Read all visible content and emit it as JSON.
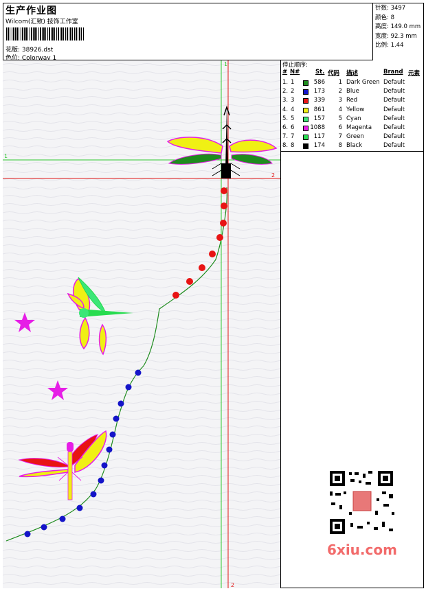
{
  "header": {
    "title": "生产作业图",
    "subtitle": "Wilcom(汇致) 技饰工作室",
    "design_label": "花版: 38926.dst",
    "colorway_label": "色位: Colorway 1"
  },
  "stats": {
    "stitches": "针数: 3497",
    "colors": "颜色: 8",
    "height": "高度: 149.0 mm",
    "width": "宽度: 92.3 mm",
    "scale": "比例: 1.44"
  },
  "canvas": {
    "guide_label_v1": "1",
    "guide_label_h1": "1",
    "guide_label_h2": "2",
    "guide_label_v2": "2"
  },
  "stop_sequence": {
    "title": "停止顺序:",
    "headers": [
      "#",
      "N#",
      "St.",
      "代码",
      "描述",
      "Brand",
      "元素"
    ],
    "rows": [
      {
        "num": "1.",
        "n": "1",
        "color": "#1e8c1e",
        "st": "586",
        "code": "1",
        "desc": "Dark Green",
        "brand": "Default"
      },
      {
        "num": "2.",
        "n": "2",
        "color": "#1414c8",
        "st": "173",
        "code": "2",
        "desc": "Blue",
        "brand": "Default"
      },
      {
        "num": "3.",
        "n": "3",
        "color": "#e81414",
        "st": "339",
        "code": "3",
        "desc": "Red",
        "brand": "Default"
      },
      {
        "num": "4.",
        "n": "4",
        "color": "#f0f014",
        "st": "861",
        "code": "4",
        "desc": "Yellow",
        "brand": "Default"
      },
      {
        "num": "5.",
        "n": "5",
        "color": "#3ce678",
        "st": "157",
        "code": "5",
        "desc": "Cyan",
        "brand": "Default"
      },
      {
        "num": "6.",
        "n": "6",
        "color": "#e61ee6",
        "st": "1088",
        "code": "6",
        "desc": "Magenta",
        "brand": "Default"
      },
      {
        "num": "7.",
        "n": "7",
        "color": "#28dc50",
        "st": "117",
        "code": "7",
        "desc": "Green",
        "brand": "Default"
      },
      {
        "num": "8.",
        "n": "8",
        "color": "#000000",
        "st": "174",
        "code": "8",
        "desc": "Black",
        "brand": "Default"
      }
    ]
  },
  "watermark": {
    "text": "6xiu.com"
  },
  "icons": {
    "qr": "qr-code-icon",
    "barcode": "barcode-icon"
  }
}
